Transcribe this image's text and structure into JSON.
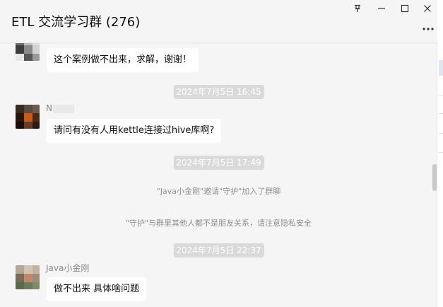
{
  "window": {
    "title": "ETL 交流学习群 (276)"
  },
  "controls": {
    "pin_icon": "pin-icon",
    "minimize_icon": "minimize-icon",
    "maximize_icon": "maximize-icon",
    "close_icon": "close-icon",
    "more_icon": "more-icon"
  },
  "messages": {
    "m1": {
      "text": "这个案例做不出来，求解，谢谢！"
    },
    "t1": "2024年7月5日 16:45",
    "m2": {
      "sender": "N",
      "text": "请问有没有人用kettle连接过hive库啊?"
    },
    "t2": "2024年7月5日 17:49",
    "sys1": "\"Java小金刚\"邀请\"守护\"加入了群聊",
    "sys2": "\"守护\"与群里其他人都不是朋友关系，请注意隐私安全",
    "t3": "2024年7月5日 22:37",
    "m3": {
      "sender": "Java小金刚",
      "text": "做不出来 具体啥问题"
    }
  },
  "colors": {
    "background": "#f5f5f5",
    "bubble": "#ffffff",
    "time_badge": "#dadada"
  }
}
